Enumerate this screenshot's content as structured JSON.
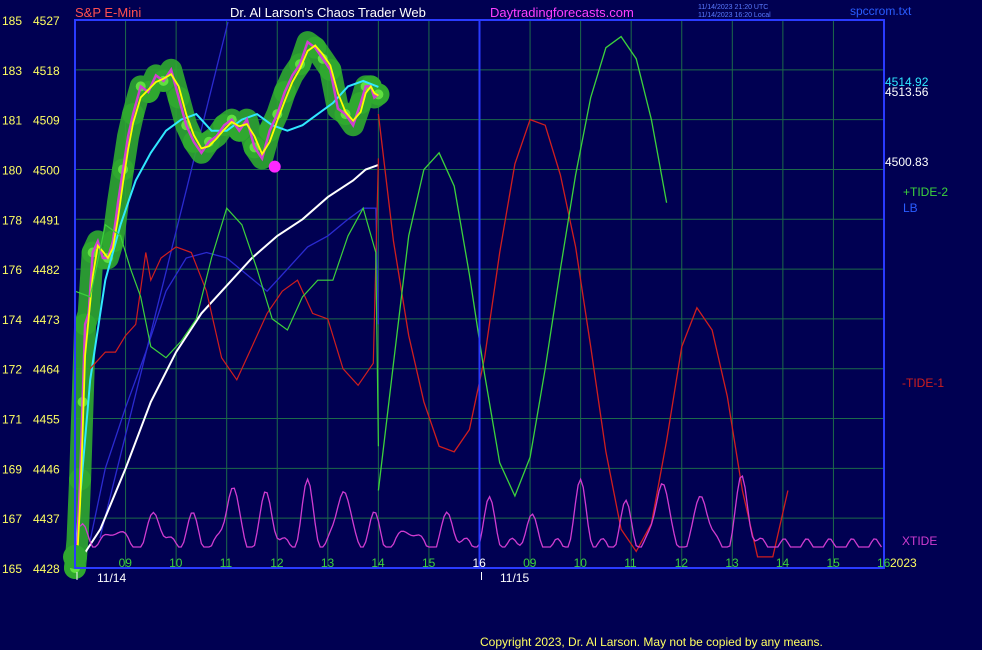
{
  "header": {
    "symbol": "S&P E-Mini",
    "site_title": "Dr. Al Larson's Chaos Trader Web",
    "site_url": "Daytradingforecasts.com",
    "stamp_utc": "11/14/2023 21:20 UTC",
    "stamp_local": "11/14/2023 16:20 Local",
    "file_name": "spccrom.txt"
  },
  "footer": {
    "copyright": "Copyright 2023, Dr. Al Larson. May not be copied by any means."
  },
  "colors": {
    "background": "#000052",
    "grid": "#1c6a4a",
    "frame": "#2a3bff",
    "price_bars": "#d040d0",
    "price_average": "#ffff00",
    "fast_average": "#30e8ff",
    "slow_average": "#ffffff",
    "tide1": "#d01e1e",
    "tide2": "#3cd23c",
    "lb": "#2a2ad0",
    "xtide": "#d03cd0",
    "halo": "#2fa82f",
    "halo_core": "#60e040",
    "low_marker": "#ff28ff"
  },
  "chart_data": {
    "type": "line",
    "title": "S&P E-Mini",
    "axes": {
      "left_labels": [
        {
          "ticker": "185",
          "price": "4527"
        },
        {
          "ticker": "183",
          "price": "4518"
        },
        {
          "ticker": "181",
          "price": "4509"
        },
        {
          "ticker": "180",
          "price": "4500"
        },
        {
          "ticker": "178",
          "price": "4491"
        },
        {
          "ticker": "176",
          "price": "4482"
        },
        {
          "ticker": "174",
          "price": "4473"
        },
        {
          "ticker": "172",
          "price": "4464"
        },
        {
          "ticker": "171",
          "price": "4455"
        },
        {
          "ticker": "169",
          "price": "4446"
        },
        {
          "ticker": "167",
          "price": "4437"
        },
        {
          "ticker": "165",
          "price": "4428"
        }
      ],
      "ylim": [
        4428,
        4527
      ],
      "xlim": [
        8.0,
        16.0
      ],
      "hour_ticks": [
        "09",
        "10",
        "11",
        "12",
        "13",
        "14",
        "15",
        "16",
        "09",
        "10",
        "11",
        "12",
        "13",
        "14",
        "15",
        "16"
      ],
      "day1_label": "11/14",
      "day2_label": "11/15",
      "year_label": "2023",
      "split_hour": 8
    },
    "price_labels": {
      "fast": "4514.92",
      "current": "4513.56",
      "slow": "4500.83"
    },
    "legend": {
      "tide2": "+TIDE-2",
      "lb": "LB",
      "tide1": "-TIDE-1",
      "xtide": "XTIDE"
    },
    "series": {
      "price": {
        "x": [
          0.0,
          0.05,
          0.1,
          0.15,
          0.2,
          0.27,
          0.35,
          0.45,
          0.55,
          0.65,
          0.75,
          0.85,
          0.95,
          1.05,
          1.15,
          1.3,
          1.45,
          1.6,
          1.75,
          1.9,
          2.05,
          2.2,
          2.35,
          2.5,
          2.65,
          2.8,
          2.95,
          3.1,
          3.25,
          3.4,
          3.55,
          3.7,
          3.85,
          4.0,
          4.15,
          4.3,
          4.45,
          4.6,
          4.75,
          4.9,
          5.05,
          5.2,
          5.35,
          5.5,
          5.65,
          5.75,
          5.85,
          5.92,
          6.0
        ],
        "y": [
          4428,
          4433,
          4444,
          4458,
          4472,
          4474,
          4485,
          4487,
          4484,
          4484,
          4487,
          4494,
          4500,
          4506,
          4510,
          4515,
          4514,
          4517,
          4516,
          4518,
          4513,
          4508,
          4505,
          4503,
          4505,
          4506,
          4508,
          4509,
          4507,
          4509,
          4504,
          4502,
          4507,
          4510,
          4514,
          4517,
          4519,
          4523,
          4522,
          4520,
          4518,
          4511,
          4510,
          4508,
          4512,
          4515,
          4515,
          4513,
          4513.56
        ]
      },
      "fast_average": {
        "x": [
          0.0,
          0.3,
          0.6,
          0.9,
          1.2,
          1.5,
          1.8,
          2.1,
          2.4,
          2.7,
          3.0,
          3.3,
          3.6,
          3.9,
          4.2,
          4.5,
          4.8,
          5.1,
          5.4,
          5.7,
          6.0
        ],
        "y": [
          4430,
          4462,
          4480,
          4490,
          4498,
          4503,
          4507,
          4509,
          4510,
          4507,
          4507,
          4509,
          4510,
          4508,
          4507,
          4508,
          4510,
          4512,
          4515,
          4516,
          4514.92
        ]
      },
      "slow_average": {
        "x": [
          0.0,
          0.5,
          1.0,
          1.5,
          2.0,
          2.5,
          3.0,
          3.5,
          4.0,
          4.5,
          5.0,
          5.5,
          5.75,
          6.0
        ],
        "y": [
          4428,
          4435,
          4446,
          4458,
          4467,
          4474,
          4479,
          4484,
          4488,
          4491,
          4495,
          4498,
          4500,
          4500.83
        ]
      },
      "tide1": {
        "x": [
          6.0,
          6.3,
          6.6,
          6.9,
          7.2,
          7.5,
          7.8,
          8.1,
          8.4,
          8.7,
          9.0,
          9.3,
          9.6,
          9.9,
          10.2,
          10.5,
          10.8,
          11.1,
          11.4,
          11.7,
          12.0,
          12.3,
          12.6,
          12.9,
          13.2,
          13.5,
          13.8,
          14.1
        ],
        "y": [
          4510,
          4487,
          4470,
          4458,
          4450,
          4449,
          4453,
          4466,
          4485,
          4501,
          4509,
          4508,
          4499,
          4486,
          4468,
          4449,
          4435,
          4431,
          4436,
          4451,
          4468,
          4475,
          4471,
          4459,
          4442,
          4430,
          4430,
          4442
        ]
      },
      "tide2": {
        "x": [
          6.0,
          6.3,
          6.6,
          6.9,
          7.2,
          7.5,
          7.8,
          8.1,
          8.4,
          8.7,
          9.0,
          9.3,
          9.6,
          9.9,
          10.2,
          10.5,
          10.8,
          11.1,
          11.4,
          11.7,
          12.0,
          12.3,
          12.6,
          12.9,
          13.2,
          13.5,
          13.8,
          14.1
        ],
        "y": [
          4442,
          4465,
          4488,
          4500,
          4503,
          4497,
          4481,
          4463,
          4447,
          4441,
          4448,
          4464,
          4482,
          4499,
          4513,
          4522,
          4524,
          4520,
          4509,
          4494
        ],
        "x_trim": true
      },
      "xtide_peaks": [
        {
          "x": 0.2,
          "h": 0.25
        },
        {
          "x": 0.8,
          "h": 0.3
        },
        {
          "x": 1.6,
          "h": 0.5
        },
        {
          "x": 2.3,
          "h": 0.4
        },
        {
          "x": 3.1,
          "h": 0.9
        },
        {
          "x": 3.8,
          "h": 0.75
        },
        {
          "x": 4.6,
          "h": 0.85
        },
        {
          "x": 5.3,
          "h": 0.9
        },
        {
          "x": 5.9,
          "h": 0.4
        },
        {
          "x": 6.6,
          "h": 0.3
        },
        {
          "x": 7.4,
          "h": 0.45
        },
        {
          "x": 8.2,
          "h": 0.6
        },
        {
          "x": 9.0,
          "h": 0.4
        },
        {
          "x": 10.0,
          "h": 0.85
        },
        {
          "x": 10.9,
          "h": 0.55
        },
        {
          "x": 11.6,
          "h": 1.0
        },
        {
          "x": 12.4,
          "h": 0.8
        },
        {
          "x": 13.2,
          "h": 0.95
        }
      ],
      "low_marker": {
        "x": 3.95,
        "y": 4500.5
      }
    }
  }
}
